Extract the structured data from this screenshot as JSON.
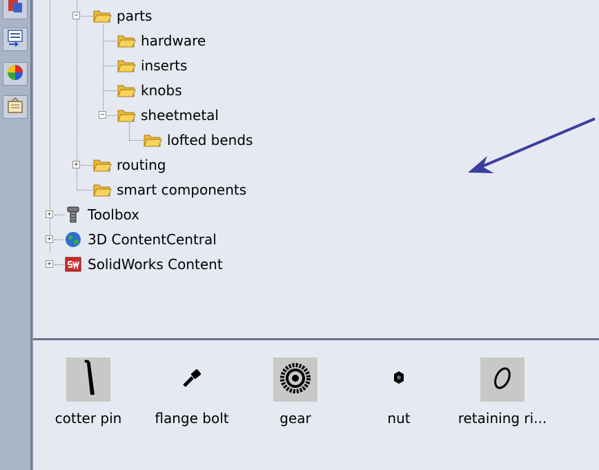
{
  "sidebar": {
    "buttons": [
      {
        "icon": "design-library-icon"
      },
      {
        "icon": "property-manager-icon"
      },
      {
        "icon": "appearances-icon"
      },
      {
        "icon": "custom-properties-icon"
      }
    ]
  },
  "tree": {
    "parts": "parts",
    "hardware": "hardware",
    "inserts": "inserts",
    "knobs": "knobs",
    "sheetmetal": "sheetmetal",
    "lofted_bends": "lofted bends",
    "routing": "routing",
    "smart_components": "smart components",
    "toolbox": "Toolbox",
    "content_central": "3D ContentCentral",
    "solidworks_content": "SolidWorks Content",
    "expander_expanded": "−",
    "expander_collapsed": "+"
  },
  "palette": {
    "items": [
      {
        "label": "cotter pin",
        "icon": "cotter-pin-icon",
        "selected": true
      },
      {
        "label": "flange bolt",
        "icon": "flange-bolt-icon",
        "selected": false
      },
      {
        "label": "gear",
        "icon": "gear-icon",
        "selected": true
      },
      {
        "label": "nut",
        "icon": "nut-icon",
        "selected": false
      },
      {
        "label": "retaining ri...",
        "icon": "retaining-ring-icon",
        "selected": true
      }
    ]
  },
  "colors": {
    "folder": "#f6d35b",
    "arrow": "#3a3f9e",
    "background": "#e6e9f2"
  }
}
